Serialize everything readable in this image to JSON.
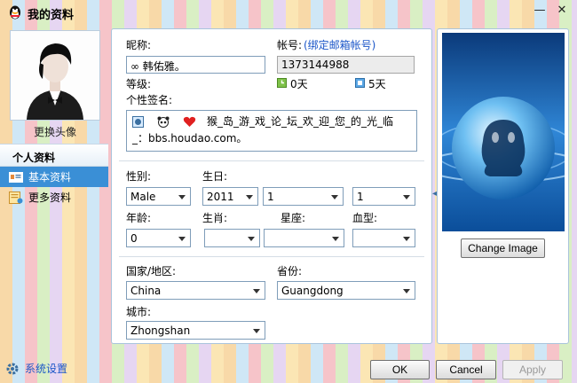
{
  "window": {
    "title": "我的资料",
    "min_glyph": "—",
    "close_glyph": "✕"
  },
  "left": {
    "change_avatar": "更换头像",
    "nav_header": "个人资料",
    "nav_items": [
      {
        "label": "基本资料",
        "active": true
      },
      {
        "label": "更多资料",
        "active": false
      }
    ],
    "settings_label": "系统设置"
  },
  "profile": {
    "nickname_label": "昵称:",
    "nickname_value": "∞   韩佑雅。",
    "account_label": "帐号:",
    "bind_email_link": "(绑定邮箱帐号)",
    "account_value": "1373144988",
    "level_label": "等级:",
    "online_days": "0天",
    "active_days": "5天",
    "signature_label": "个性签名:",
    "signature_line1": "猴_岛_游_戏_论_坛_欢_迎_您_的_光_临",
    "signature_line2": "_：bbs.houdao.com。",
    "gender_label": "性别:",
    "gender_value": "Male",
    "birthday_label": "生日:",
    "birth_year": "2011",
    "birth_month": "1",
    "birth_day": "1",
    "age_label": "年龄:",
    "age_value": "0",
    "zodiac_label": "生肖:",
    "zodiac_value": "",
    "constellation_label": "星座:",
    "constellation_value": "",
    "blood_label": "血型:",
    "blood_value": "",
    "country_label": "国家/地区:",
    "country_value": "China",
    "province_label": "省份:",
    "province_value": "Guangdong",
    "city_label": "城市:",
    "city_value": "Zhongshan"
  },
  "right": {
    "change_image_button": "Change Image"
  },
  "footer": {
    "ok": "OK",
    "cancel": "Cancel",
    "apply": "Apply"
  },
  "colors": {
    "accent": "#3a8fd6",
    "link": "#1b56c8",
    "border": "#7f9db9"
  }
}
